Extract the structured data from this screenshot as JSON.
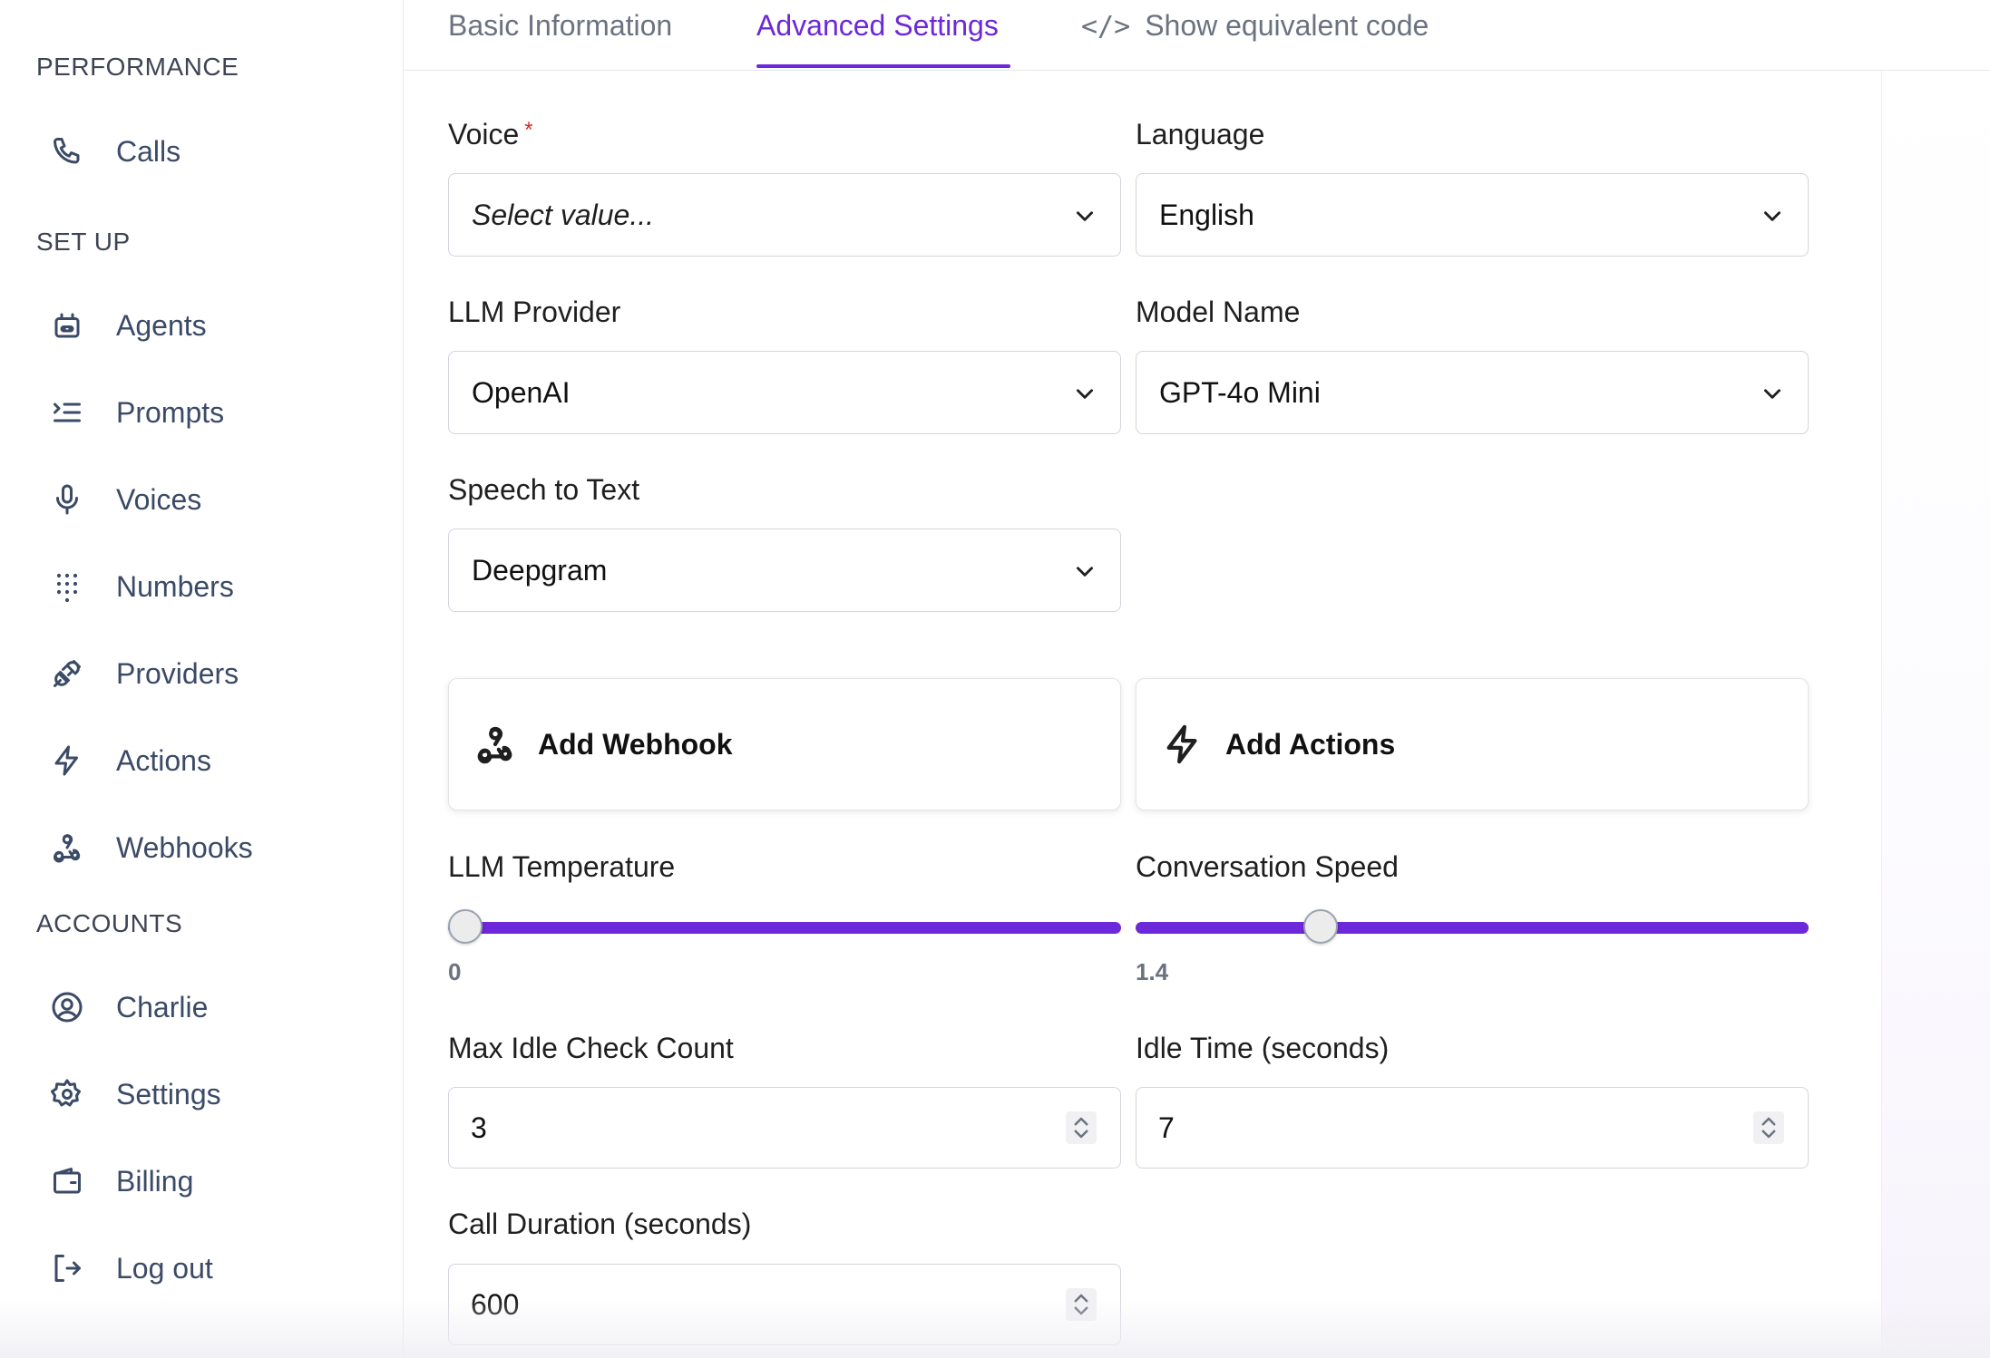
{
  "sidebar": {
    "sections": [
      {
        "title": "PERFORMANCE",
        "items": [
          {
            "label": "Calls",
            "icon": "phone-icon"
          }
        ]
      },
      {
        "title": "SET UP",
        "items": [
          {
            "label": "Agents",
            "icon": "robot-icon"
          },
          {
            "label": "Prompts",
            "icon": "prompt-list-icon"
          },
          {
            "label": "Voices",
            "icon": "microphone-icon"
          },
          {
            "label": "Numbers",
            "icon": "dialpad-icon"
          },
          {
            "label": "Providers",
            "icon": "plug-icon"
          },
          {
            "label": "Actions",
            "icon": "lightning-icon"
          },
          {
            "label": "Webhooks",
            "icon": "webhook-icon"
          }
        ]
      },
      {
        "title": "ACCOUNTS",
        "items": [
          {
            "label": "Charlie",
            "icon": "user-circle-icon"
          },
          {
            "label": "Settings",
            "icon": "gear-icon"
          },
          {
            "label": "Billing",
            "icon": "wallet-icon"
          },
          {
            "label": "Log out",
            "icon": "logout-icon"
          }
        ]
      }
    ]
  },
  "tabs": {
    "basic": "Basic Information",
    "advanced": "Advanced Settings",
    "code": "Show equivalent code",
    "code_glyph": "</>",
    "active": "advanced"
  },
  "form": {
    "voice": {
      "label": "Voice",
      "required_mark": "*",
      "value": "",
      "placeholder": "Select value..."
    },
    "language": {
      "label": "Language",
      "value": "English"
    },
    "llm_provider": {
      "label": "LLM Provider",
      "value": "OpenAI"
    },
    "model_name": {
      "label": "Model Name",
      "value": "GPT-4o Mini"
    },
    "speech_to_text": {
      "label": "Speech to Text",
      "value": "Deepgram"
    },
    "add_webhook": {
      "label": "Add Webhook",
      "icon": "webhook-icon"
    },
    "add_actions": {
      "label": "Add Actions",
      "icon": "lightning-icon"
    },
    "llm_temperature": {
      "label": "LLM Temperature",
      "value": "0",
      "position_fraction": 0.0
    },
    "conversation_speed": {
      "label": "Conversation Speed",
      "value": "1.4",
      "position_fraction": 0.263
    },
    "max_idle_check_count": {
      "label": "Max Idle Check Count",
      "value": "3"
    },
    "idle_time": {
      "label": "Idle Time (seconds)",
      "value": "7"
    },
    "call_duration": {
      "label": "Call Duration (seconds)",
      "value": "600"
    }
  },
  "colors": {
    "accent": "#6d28d9",
    "sidebar_text": "#3b4a66",
    "required": "#dc2626"
  }
}
